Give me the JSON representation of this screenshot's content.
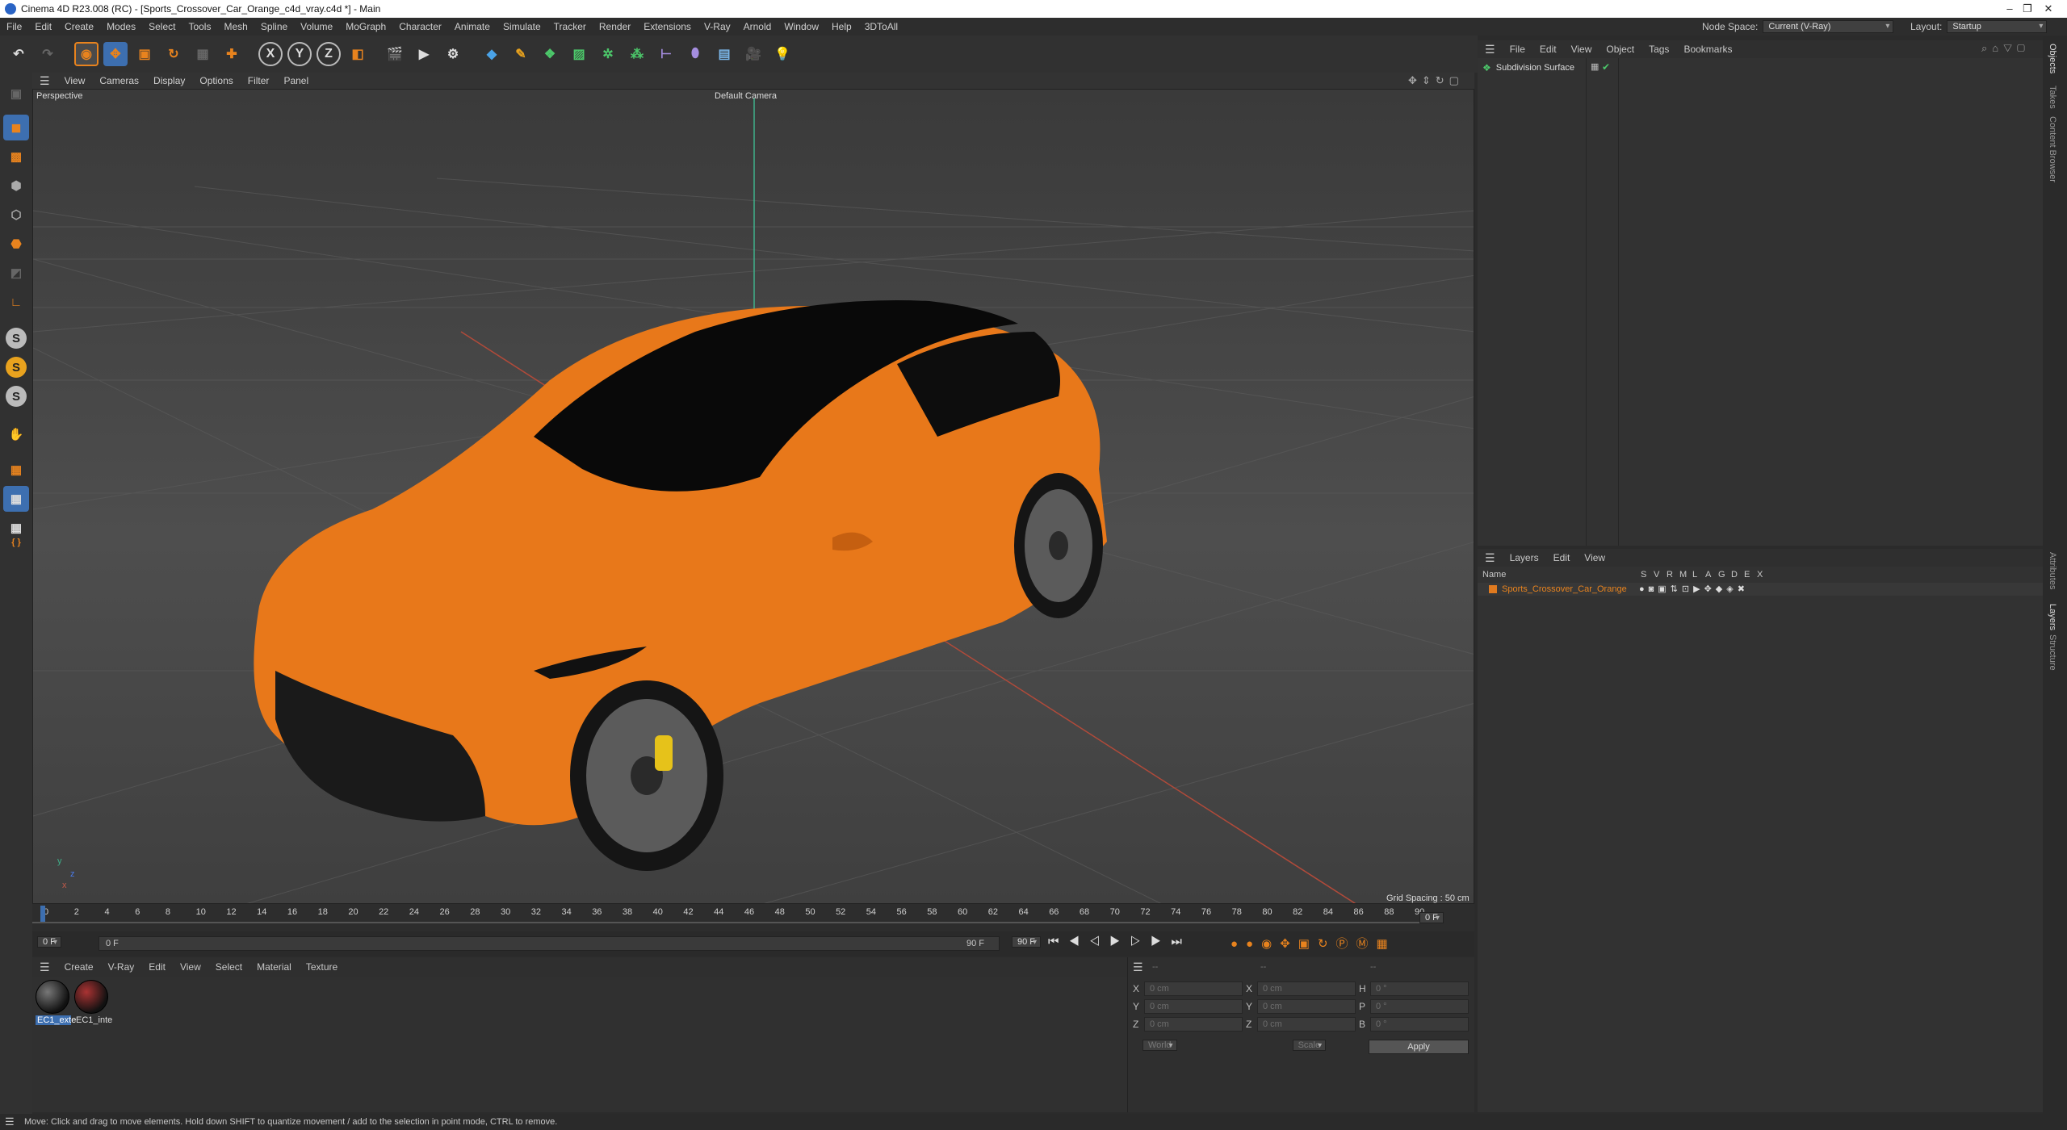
{
  "window": {
    "title": "Cinema 4D R23.008 (RC) - [Sports_Crossover_Car_Orange_c4d_vray.c4d *] - Main",
    "minimize": "–",
    "maximize": "❐",
    "close": "✕"
  },
  "menu": [
    "File",
    "Edit",
    "Create",
    "Modes",
    "Select",
    "Tools",
    "Mesh",
    "Spline",
    "Volume",
    "MoGraph",
    "Character",
    "Animate",
    "Simulate",
    "Tracker",
    "Render",
    "Extensions",
    "V-Ray",
    "Arnold",
    "Window",
    "Help",
    "3DToAll"
  ],
  "node_space": {
    "label": "Node Space:",
    "value": "Current (V-Ray)"
  },
  "layout": {
    "label": "Layout:",
    "value": "Startup"
  },
  "viewport": {
    "menu": [
      "View",
      "Cameras",
      "Display",
      "Options",
      "Filter",
      "Panel"
    ],
    "view_name": "Perspective",
    "camera": "Default Camera",
    "grid_spacing": "Grid Spacing : 50 cm",
    "axis": {
      "y": "y",
      "z": "z",
      "x": "x"
    }
  },
  "timeline": {
    "ticks": [
      "0",
      "2",
      "4",
      "6",
      "8",
      "10",
      "12",
      "14",
      "16",
      "18",
      "20",
      "22",
      "24",
      "26",
      "28",
      "30",
      "32",
      "34",
      "36",
      "38",
      "40",
      "42",
      "44",
      "46",
      "48",
      "50",
      "52",
      "54",
      "56",
      "58",
      "60",
      "62",
      "64",
      "66",
      "68",
      "70",
      "72",
      "74",
      "76",
      "78",
      "80",
      "82",
      "84",
      "86",
      "88",
      "90"
    ],
    "current_frame": "0 F"
  },
  "transport": {
    "start": "0 F",
    "slider_start": "0 F",
    "slider_end": "90 F",
    "end": "90 F"
  },
  "material_manager": {
    "menu": [
      "Create",
      "V-Ray",
      "Edit",
      "View",
      "Select",
      "Material",
      "Texture"
    ],
    "materials": [
      {
        "name": "EC1_exte",
        "selected": true
      },
      {
        "name": "EC1_inte",
        "selected": false
      }
    ]
  },
  "coordinates": {
    "header1": "--",
    "header2": "--",
    "header3": "--",
    "rows": [
      {
        "a": "X",
        "av": "0 cm",
        "b": "X",
        "bv": "0 cm",
        "c": "H",
        "cv": "0 °"
      },
      {
        "a": "Y",
        "av": "0 cm",
        "b": "Y",
        "bv": "0 cm",
        "c": "P",
        "cv": "0 °"
      },
      {
        "a": "Z",
        "av": "0 cm",
        "b": "Z",
        "bv": "0 cm",
        "c": "B",
        "cv": "0 °"
      }
    ],
    "mode": "World",
    "transform": "Scale",
    "apply": "Apply"
  },
  "object_manager": {
    "menu": [
      "File",
      "Edit",
      "View",
      "Object",
      "Tags",
      "Bookmarks"
    ],
    "objects": [
      {
        "name": "Subdivision Surface"
      }
    ]
  },
  "layer_manager": {
    "menu": [
      "Layers",
      "Edit",
      "View"
    ],
    "columns": [
      "Name",
      "S",
      "V",
      "R",
      "M",
      "L",
      "A",
      "G",
      "D",
      "E",
      "X"
    ],
    "layers": [
      {
        "name": "Sports_Crossover_Car_Orange",
        "color": "#e07a1f"
      }
    ]
  },
  "side_tabs": [
    "Objects",
    "Takes",
    "Content Browser",
    "Attributes",
    "Layers",
    "Structure"
  ],
  "status": "Move: Click and drag to move elements. Hold down SHIFT to quantize movement / add to the selection in point mode, CTRL to remove.",
  "colors": {
    "accent": "#e8831e",
    "select_blue": "#3d6fb0",
    "car_body": "#e8781a"
  }
}
